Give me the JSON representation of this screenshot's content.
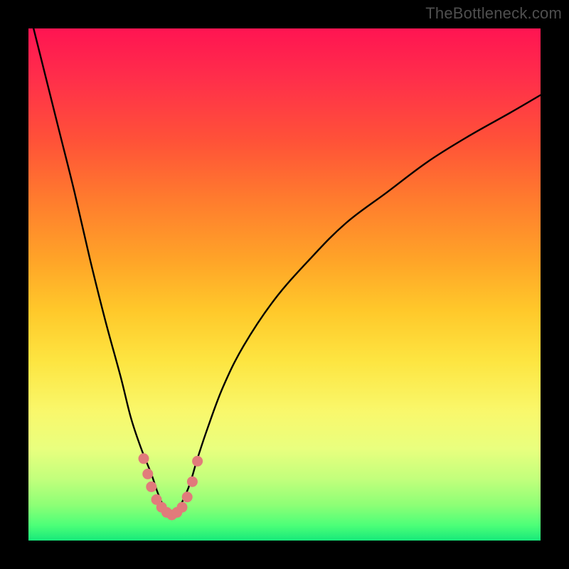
{
  "watermark": "TheBottleneck.com",
  "colors": {
    "frame": "#000000",
    "gradient_top": "#ff1452",
    "gradient_bottom": "#17e97a",
    "curve": "#000000",
    "marker": "#e17b7b",
    "watermark_text": "#4f4f4f"
  },
  "chart_data": {
    "type": "line",
    "title": "",
    "xlabel": "",
    "ylabel": "",
    "xlim": [
      0,
      100
    ],
    "ylim": [
      0,
      100
    ],
    "grid": false,
    "note": "Axes are unlabeled in the image; units are approximate percentages of plot width/height. y is measured from the top of the plot area (0) to the bottom (100).",
    "series": [
      {
        "name": "curve",
        "color": "#000000",
        "x": [
          0,
          3,
          6,
          9,
          12,
          15,
          18,
          20,
          22,
          24,
          25,
          26,
          27,
          28,
          29,
          30,
          31.5,
          33,
          35,
          38,
          42,
          48,
          55,
          62,
          70,
          78,
          86,
          94,
          100
        ],
        "y": [
          -4,
          8,
          20,
          32,
          45,
          57,
          68,
          76,
          82,
          87,
          90,
          92.5,
          94,
          95,
          94,
          92.5,
          89,
          84,
          78,
          70,
          62,
          53,
          45,
          38,
          32,
          26,
          21,
          16.5,
          13
        ]
      }
    ],
    "markers": {
      "name": "highlight-points",
      "color": "#e17b7b",
      "points": [
        {
          "x": 22.5,
          "y": 84
        },
        {
          "x": 23.3,
          "y": 87
        },
        {
          "x": 24.0,
          "y": 89.5
        },
        {
          "x": 25.0,
          "y": 92
        },
        {
          "x": 26.0,
          "y": 93.5
        },
        {
          "x": 27.0,
          "y": 94.5
        },
        {
          "x": 28.0,
          "y": 95
        },
        {
          "x": 29.0,
          "y": 94.5
        },
        {
          "x": 30.0,
          "y": 93.5
        },
        {
          "x": 31.0,
          "y": 91.5
        },
        {
          "x": 32.0,
          "y": 88.5
        },
        {
          "x": 33.0,
          "y": 84.5
        }
      ]
    }
  }
}
